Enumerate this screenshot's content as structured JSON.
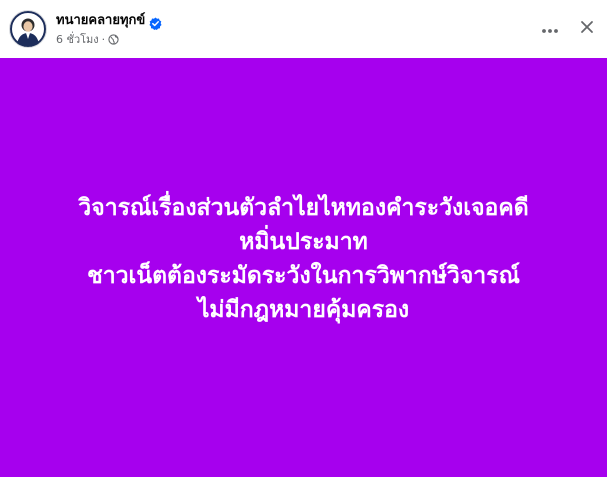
{
  "post": {
    "author_name": "ทนายคลายทุกข์",
    "time_ago": "6 ชั่วโมง",
    "meta_separator": "·",
    "audience_icon": "globe-icon",
    "verified_icon": "verified-badge-icon",
    "more_icon": "more-dots-icon",
    "close_icon": "close-icon",
    "avatar_icon": "profile-avatar"
  },
  "content": {
    "background_color": "#a600ee",
    "text_color": "#ffffff",
    "lines": [
      "วิจารณ์เรื่องส่วนตัวลำไยไหทองคำระวังเจอคดี",
      "หมิ่นประมาท",
      "ชาวเน็ตต้องระมัดระวังในการวิพากษ์วิจารณ์",
      "ไม่มีกฎหมายคุ้มครอง"
    ]
  },
  "colors": {
    "verified_blue": "#0866ff",
    "meta_gray": "#65676b",
    "name_black": "#050505"
  }
}
